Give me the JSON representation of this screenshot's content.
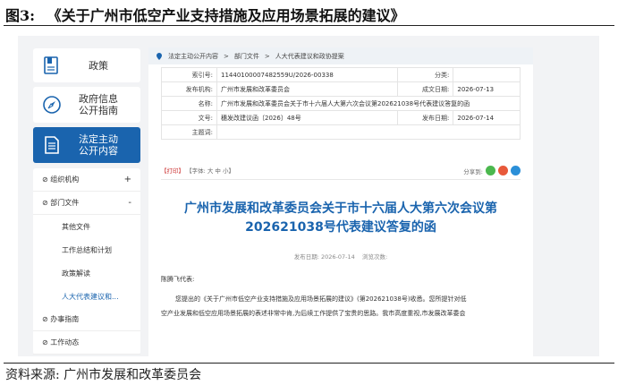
{
  "figure": {
    "label": "图3:",
    "title": "《关于广州市低空产业支持措施及应用场景拓展的建议》",
    "source": "资料来源: 广州市发展和改革委员会"
  },
  "sidebar": {
    "tiles": [
      {
        "label": "政策",
        "icon": "document-icon"
      },
      {
        "label": "政府信息公开指南",
        "icon": "compass-icon"
      },
      {
        "label": "法定主动公开内容",
        "icon": "file-list-icon"
      }
    ],
    "menu": {
      "org": {
        "label": "组织机构",
        "toggle": "+"
      },
      "dept": {
        "label": "部门文件",
        "toggle": "-"
      },
      "items": [
        "其他文件",
        "工作总结和计划",
        "政策解读",
        "人大代表建议和..."
      ],
      "affairs": {
        "label": "办事指南"
      },
      "more": {
        "label": "工作动态"
      }
    }
  },
  "breadcrumb": {
    "items": [
      "法定主动公开内容",
      "部门文件",
      "人大代表建议和政协提案"
    ],
    "sep": ">"
  },
  "meta": {
    "index_label": "索引号:",
    "index_value": "11440100007482559U/2026-00338",
    "category_label": "分类:",
    "category_value": "",
    "publisher_label": "发布机构:",
    "publisher_value": "广州市发展和改革委员会",
    "created_label": "成文日期:",
    "created_value": "2026-07-13",
    "name_label": "名称:",
    "name_value": "广州市发展和改革委员会关于市十六届人大第六次会议第202621038号代表建议答复的函",
    "docno_label": "文号:",
    "docno_value": "穗发改建议函〔2026〕48号",
    "pubdate_label": "发布日期:",
    "pubdate_value": "2026-07-14",
    "keywords_label": "主题词:",
    "keywords_value": ""
  },
  "tools": {
    "print": "【打印】",
    "font": "【字体: 大 中 小】",
    "share": "分享到:"
  },
  "article": {
    "title_line1": "广州市发展和改革委员会关于市十六届人大第六次会议第",
    "title_line2": "202621038号代表建议答复的函",
    "pub_date": "发布日期: 2026-07-14",
    "views": "浏览次数:",
    "salutation": "陈腾飞代表:",
    "p1": "您提出的《关于广州市低空产业支持措施及应用场景拓展的建议》(第202621038号)收悉。您所提针对低",
    "p2": "空产业发展和低空应用场景拓展的表述非常中肯,为后续工作提供了宝贵的思路。我市高度重视,市发展改革委会"
  },
  "colors": {
    "primary": "#1a64ae",
    "wechat": "#4bb84e",
    "weibo": "#e8593a",
    "qq": "#2b8fd8"
  }
}
